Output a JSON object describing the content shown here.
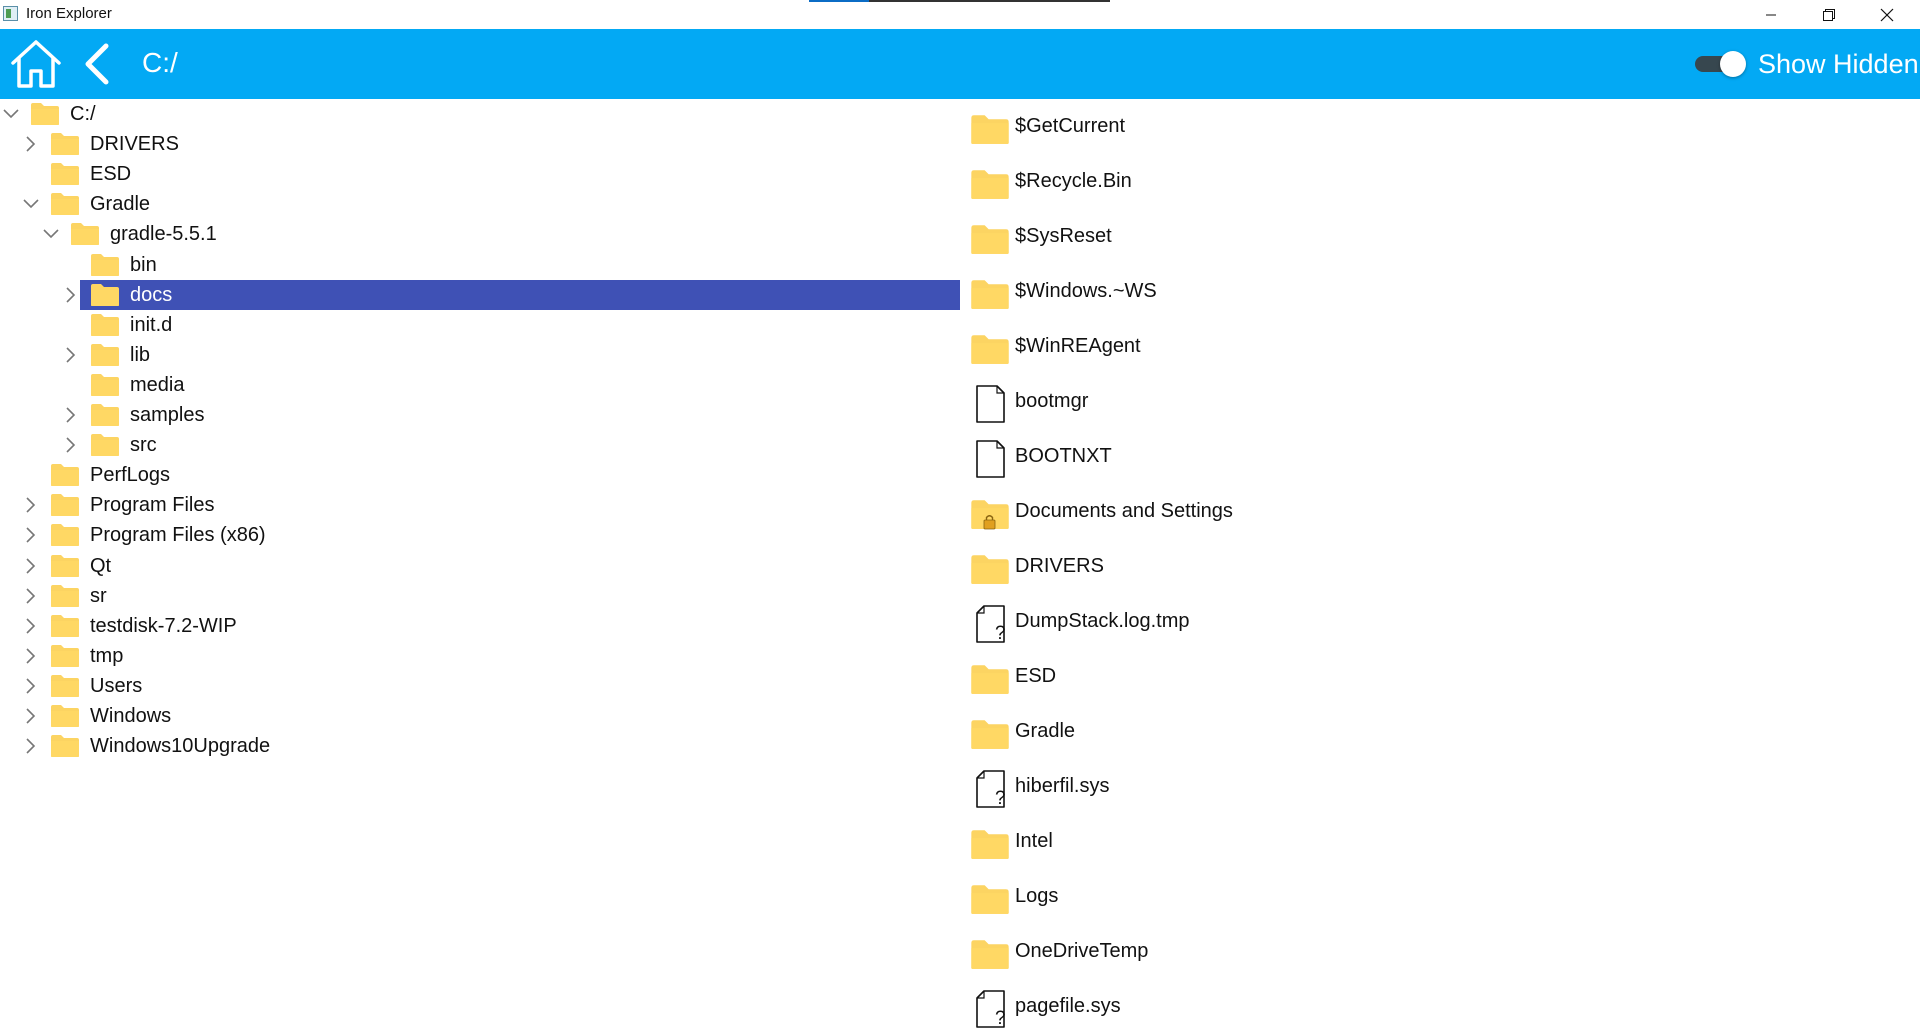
{
  "window": {
    "title": "Iron Explorer"
  },
  "toolbar": {
    "path": "C:/",
    "show_hidden_label": "Show Hidden",
    "show_hidden_on": true
  },
  "colors": {
    "accent": "#03a9f4",
    "selection": "#3f51b5",
    "folder": "#fcd462",
    "toggle_track": "#37474f"
  },
  "tree": [
    {
      "label": "C:/",
      "depth": 0,
      "expander": "expanded"
    },
    {
      "label": "DRIVERS",
      "depth": 1,
      "expander": "collapsed"
    },
    {
      "label": "ESD",
      "depth": 1,
      "expander": "none"
    },
    {
      "label": "Gradle",
      "depth": 1,
      "expander": "expanded"
    },
    {
      "label": "gradle-5.5.1",
      "depth": 2,
      "expander": "expanded"
    },
    {
      "label": "bin",
      "depth": 3,
      "expander": "none"
    },
    {
      "label": "docs",
      "depth": 3,
      "expander": "collapsed",
      "selected": true
    },
    {
      "label": "init.d",
      "depth": 3,
      "expander": "none"
    },
    {
      "label": "lib",
      "depth": 3,
      "expander": "collapsed"
    },
    {
      "label": "media",
      "depth": 3,
      "expander": "none"
    },
    {
      "label": "samples",
      "depth": 3,
      "expander": "collapsed"
    },
    {
      "label": "src",
      "depth": 3,
      "expander": "collapsed"
    },
    {
      "label": "PerfLogs",
      "depth": 1,
      "expander": "none"
    },
    {
      "label": "Program Files",
      "depth": 1,
      "expander": "collapsed"
    },
    {
      "label": "Program Files (x86)",
      "depth": 1,
      "expander": "collapsed"
    },
    {
      "label": "Qt",
      "depth": 1,
      "expander": "collapsed"
    },
    {
      "label": "sr",
      "depth": 1,
      "expander": "collapsed"
    },
    {
      "label": "testdisk-7.2-WIP",
      "depth": 1,
      "expander": "collapsed"
    },
    {
      "label": "tmp",
      "depth": 1,
      "expander": "collapsed"
    },
    {
      "label": "Users",
      "depth": 1,
      "expander": "collapsed"
    },
    {
      "label": "Windows",
      "depth": 1,
      "expander": "collapsed"
    },
    {
      "label": "Windows10Upgrade",
      "depth": 1,
      "expander": "collapsed"
    }
  ],
  "files": [
    {
      "name": "$GetCurrent",
      "icon": "folder-icon"
    },
    {
      "name": "$Recycle.Bin",
      "icon": "folder-icon"
    },
    {
      "name": "$SysReset",
      "icon": "folder-icon"
    },
    {
      "name": "$Windows.~WS",
      "icon": "folder-icon"
    },
    {
      "name": "$WinREAgent",
      "icon": "folder-icon"
    },
    {
      "name": "bootmgr",
      "icon": "file-icon"
    },
    {
      "name": "BOOTNXT",
      "icon": "file-icon"
    },
    {
      "name": "Documents and Settings",
      "icon": "locked-folder-icon"
    },
    {
      "name": "DRIVERS",
      "icon": "folder-icon"
    },
    {
      "name": "DumpStack.log.tmp",
      "icon": "unknown-file-icon"
    },
    {
      "name": "ESD",
      "icon": "folder-icon"
    },
    {
      "name": "Gradle",
      "icon": "folder-icon"
    },
    {
      "name": "hiberfil.sys",
      "icon": "unknown-file-icon"
    },
    {
      "name": "Intel",
      "icon": "folder-icon"
    },
    {
      "name": "Logs",
      "icon": "folder-icon"
    },
    {
      "name": "OneDriveTemp",
      "icon": "folder-icon"
    },
    {
      "name": "pagefile.sys",
      "icon": "unknown-file-icon"
    }
  ]
}
